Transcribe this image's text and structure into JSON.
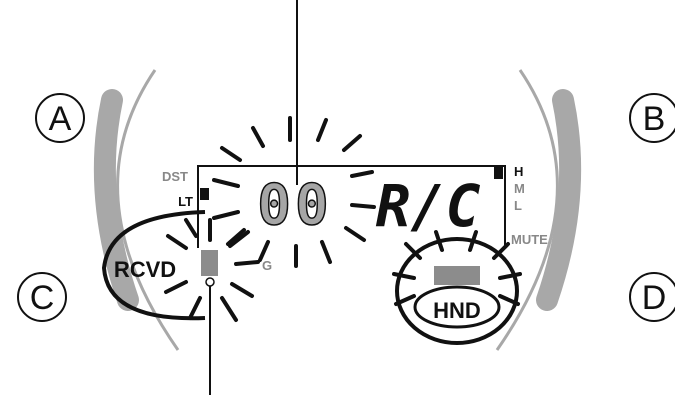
{
  "buttons": {
    "a": "A",
    "b": "B",
    "c": "C",
    "d": "D"
  },
  "indicators": {
    "dst": "DST",
    "lt": "LT",
    "h": "H",
    "m": "M",
    "l": "L",
    "mute": "MUTE",
    "g": "G"
  },
  "display": {
    "digits": "00",
    "text": "R/C"
  },
  "callouts": {
    "rcvd": "RCVD",
    "hnd": "HND"
  },
  "colors": {
    "ink": "#111111",
    "bezel": "#a8a8a8",
    "indicator": "#888888",
    "segment_fill": "#8c8c8c"
  }
}
